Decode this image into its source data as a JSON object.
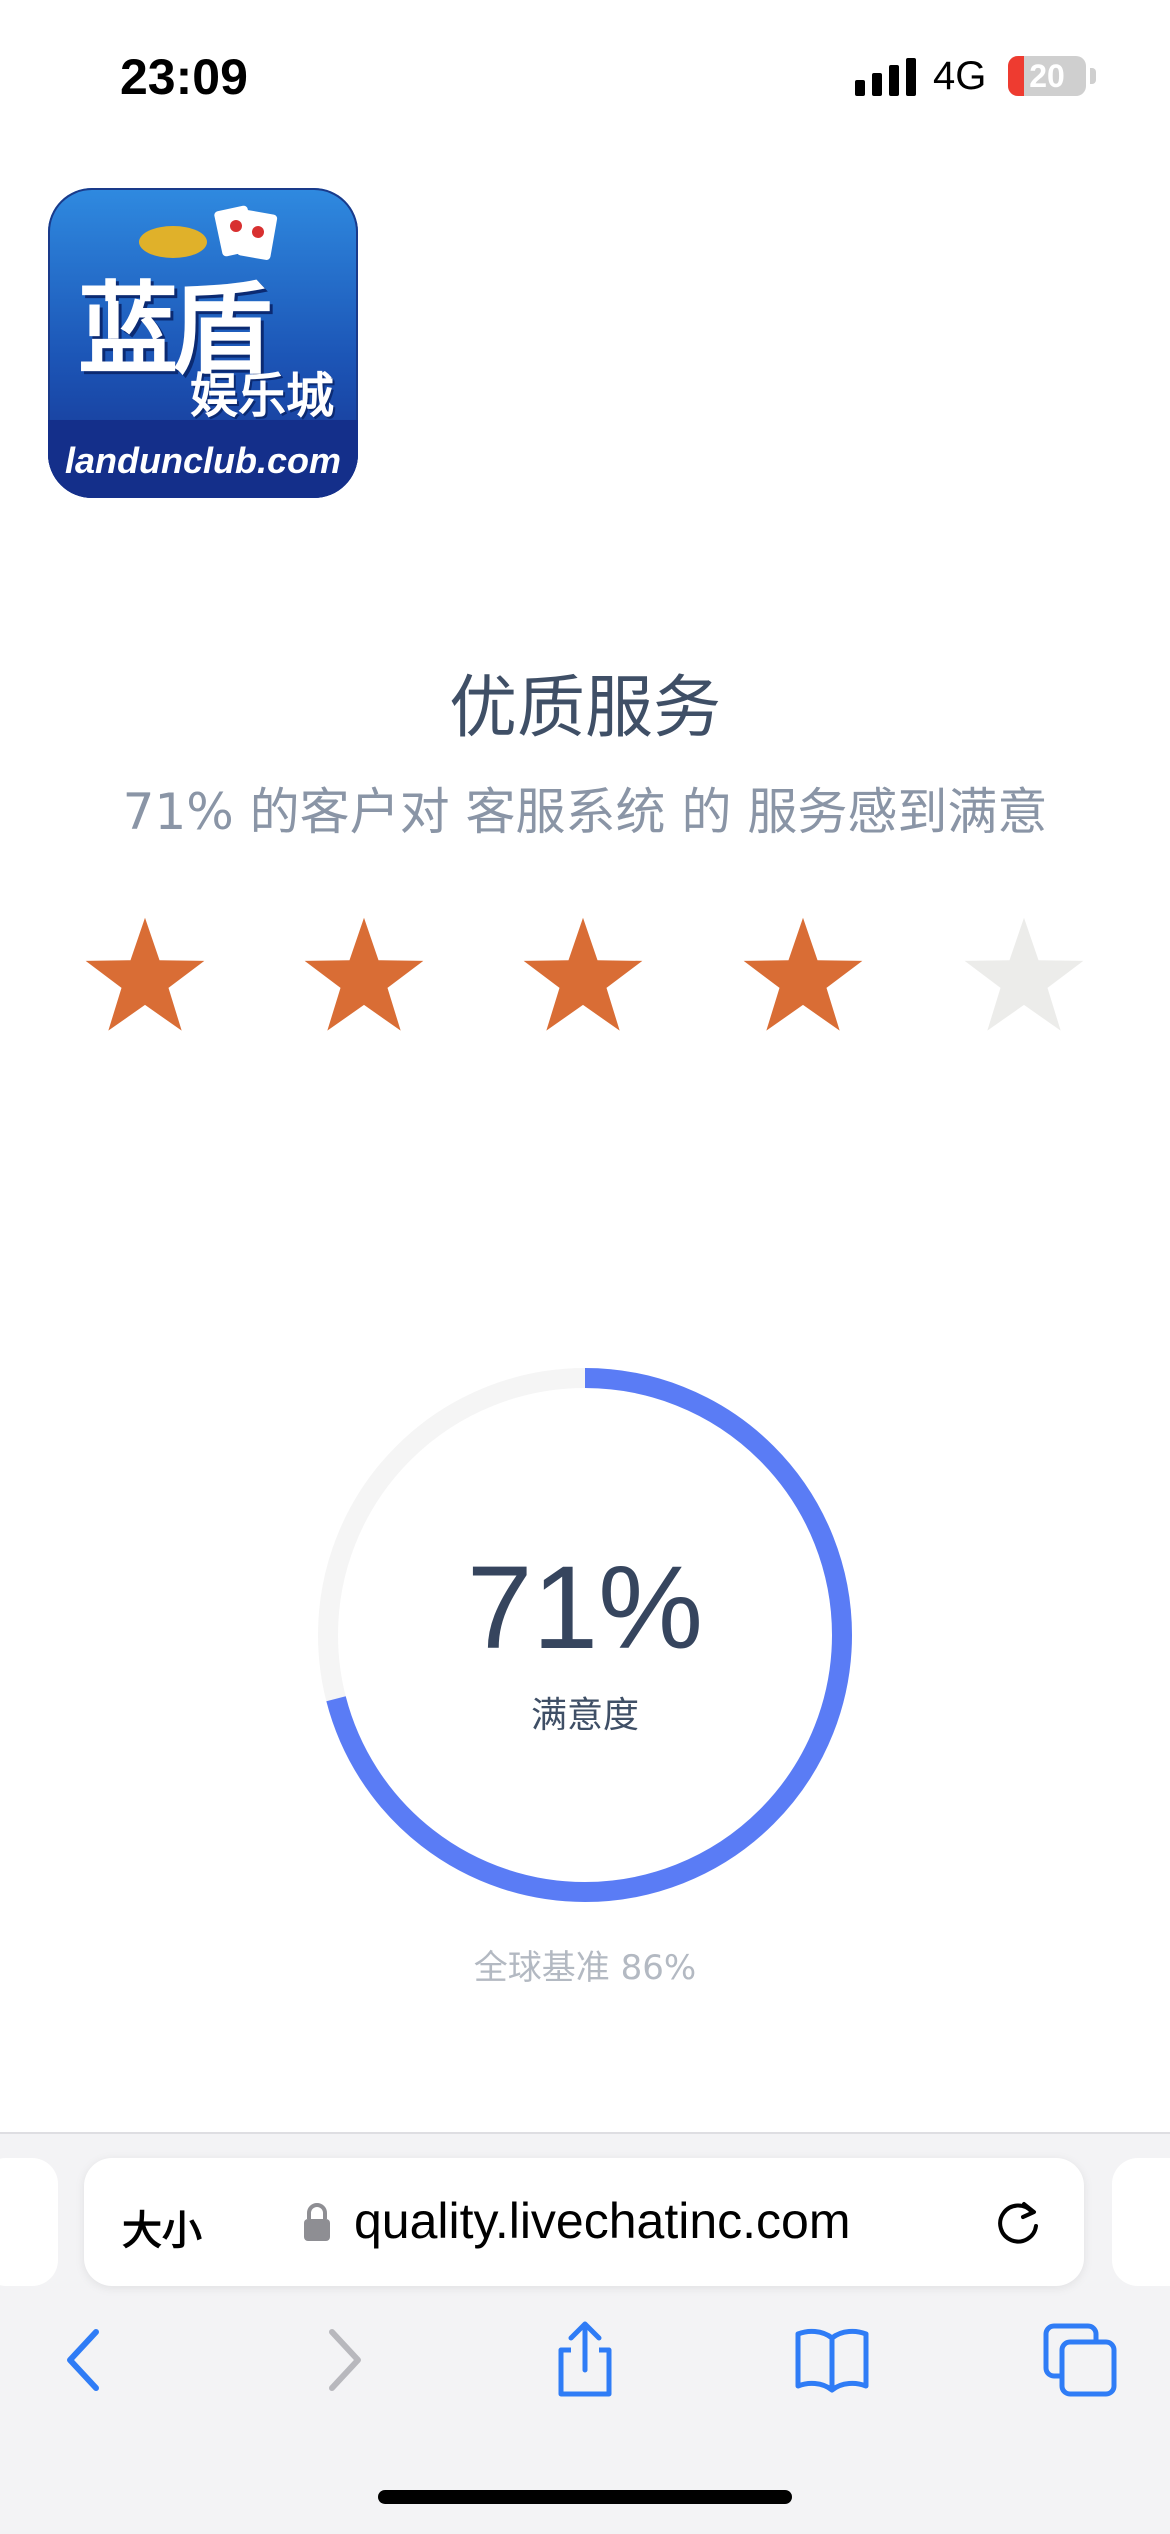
{
  "status_bar": {
    "time": "23:09",
    "network": "4G",
    "battery_level": "20",
    "battery_fraction": 0.2,
    "battery_color": "#ee3b30"
  },
  "logo": {
    "chars_main": "蓝盾",
    "chars_sub": "娱乐城",
    "domain": "landunclub.com"
  },
  "page": {
    "title": "优质服务",
    "subtitle": "71% 的客户对 客服系统 的 服务感到满意",
    "rating": {
      "filled": 4,
      "total": 5,
      "filled_color": "#d96d35",
      "empty_color": "#ececea"
    }
  },
  "gauge": {
    "percent": 71,
    "value_text": "71%",
    "label": "满意度",
    "benchmark_text": "全球基准 86%",
    "benchmark_percent": 86,
    "arc_color": "#5a7cf5",
    "track_color": "#f5f5f5"
  },
  "browser": {
    "text_size_label": "大小",
    "url": "quality.livechatinc.com",
    "accent_color": "#2f7cf6",
    "icons": [
      "back-icon",
      "forward-icon",
      "share-icon",
      "bookmarks-icon",
      "tabs-icon",
      "lock-icon",
      "reload-icon"
    ]
  }
}
